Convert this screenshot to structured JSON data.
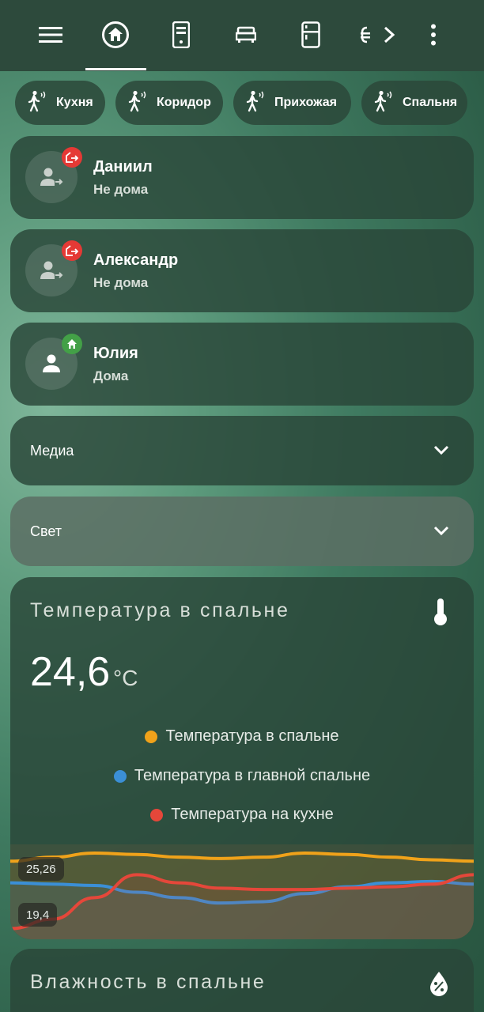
{
  "topbar": {
    "icons": [
      "menu-icon",
      "home-icon",
      "server-icon",
      "sofa-icon",
      "fridge-icon",
      "tab-partial-icon",
      "chevron-right-icon",
      "more-vert-icon"
    ]
  },
  "chips": [
    {
      "label": "Кухня",
      "icon": "motion-sensor-icon"
    },
    {
      "label": "Коридор",
      "icon": "motion-sensor-icon"
    },
    {
      "label": "Прихожая",
      "icon": "motion-sensor-icon"
    },
    {
      "label": "Спальня",
      "icon": "motion-sensor-icon"
    }
  ],
  "persons": [
    {
      "name": "Даниил",
      "status": "Не дома",
      "badge": "away",
      "badge_color": "#e53935"
    },
    {
      "name": "Александр",
      "status": "Не дома",
      "badge": "away",
      "badge_color": "#e53935"
    },
    {
      "name": "Юлия",
      "status": "Дома",
      "badge": "home",
      "badge_color": "#43a047"
    }
  ],
  "sections": [
    {
      "label": "Медиа"
    },
    {
      "label": "Свет"
    }
  ],
  "temperature_card": {
    "title": "Температура в спальне",
    "value": "24,6",
    "unit": "°C",
    "icon": "thermometer-icon",
    "legend": [
      {
        "label": "Температура в спальне",
        "color": "#f0a21a"
      },
      {
        "label": "Температура в главной спальне",
        "color": "#3b8fd6"
      },
      {
        "label": "Температура на кухне",
        "color": "#e5473a"
      }
    ],
    "max_label": "25,26",
    "min_label": "19,4"
  },
  "humidity_card": {
    "title": "Влажность в спальне",
    "icon": "water-percent-icon"
  },
  "chart_data": {
    "type": "line",
    "ylim": [
      19.4,
      25.26
    ],
    "series": [
      {
        "name": "Температура в спальне",
        "values": [
          24.6,
          24.9,
          25.2,
          25.1,
          24.9,
          24.8,
          24.9,
          25.2,
          25.1,
          24.9,
          24.7,
          24.6
        ]
      },
      {
        "name": "Температура в главной спальне",
        "values": [
          23.0,
          22.9,
          22.8,
          22.3,
          21.9,
          21.5,
          21.6,
          22.2,
          22.7,
          23.0,
          23.1,
          22.9
        ]
      },
      {
        "name": "Температура на кухне",
        "values": [
          19.6,
          20.3,
          21.9,
          23.6,
          23.0,
          22.6,
          22.5,
          22.5,
          22.6,
          22.7,
          22.9,
          23.6
        ]
      }
    ]
  }
}
